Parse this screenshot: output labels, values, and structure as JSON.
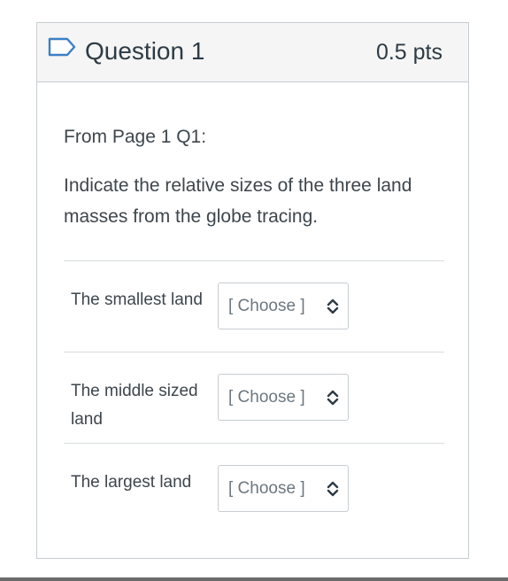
{
  "question": {
    "title": "Question 1",
    "points": "0.5 pts",
    "source": "From Page 1 Q1:",
    "text": "Indicate the relative sizes of the three land masses from the globe tracing."
  },
  "rows": [
    {
      "label": "The smallest land",
      "selected": "[ Choose ]"
    },
    {
      "label": "The middle sized land",
      "selected": "[ Choose ]"
    },
    {
      "label": "The largest land",
      "selected": "[ Choose ]"
    }
  ],
  "icons": {
    "flag": "flag-outline-icon",
    "select": "chevron-up-down-icon"
  },
  "colors": {
    "text": "#2d3b45",
    "header_bg": "#f5f5f5",
    "border": "#c7cdd1",
    "placeholder": "#6b7780"
  }
}
